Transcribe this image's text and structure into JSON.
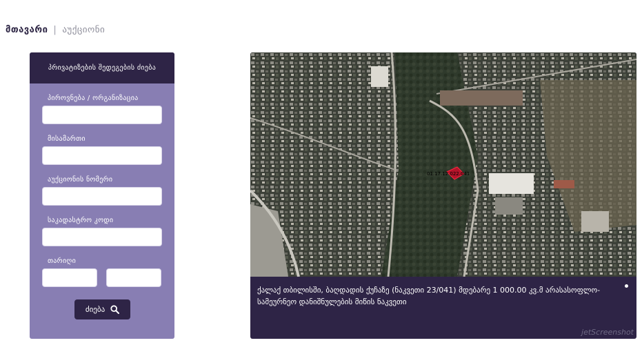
{
  "breadcrumb": {
    "home": "მთავარი",
    "separator": "|",
    "current": "აუქციონი"
  },
  "search_panel": {
    "title": "პრივატიზების შედეგების ძიება",
    "fields": [
      {
        "label": "პიროვნება / ორგანიზაცია",
        "value": ""
      },
      {
        "label": "მისამართი",
        "value": ""
      },
      {
        "label": "აუქციონის ნომერი",
        "value": ""
      },
      {
        "label": "საკადასტრო კოდი",
        "value": ""
      }
    ],
    "date_label": "თარიღი",
    "date_from": "",
    "date_to": "",
    "search_button": "ძიება"
  },
  "map_card": {
    "parcel_label": "01.17.12.022.041",
    "caption": "ქალაქ თბილისში, ბაღდადის ქუჩაზე (ნაკვეთი 23/041) მდებარე 1 000.00 კვ.მ არასასოფლო-სამეურნეო დანიშნულების მიწის ნაკვეთი"
  },
  "watermark": "jetScreenshot"
}
